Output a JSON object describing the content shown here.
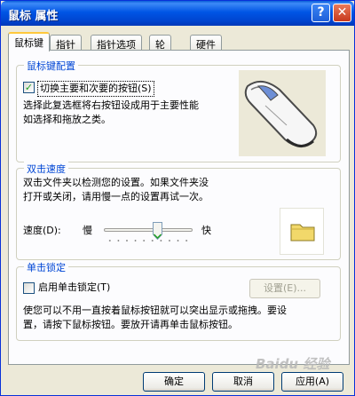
{
  "window": {
    "title": "鼠标 属性",
    "help_btn": "?",
    "close_btn": "✕"
  },
  "tabs": [
    {
      "label": "鼠标键",
      "active": true
    },
    {
      "label": "指针",
      "active": false
    },
    {
      "label": "指针选项",
      "active": false
    },
    {
      "label": "轮",
      "active": false
    },
    {
      "label": "硬件",
      "active": false
    }
  ],
  "button_config": {
    "group_title": "鼠标键配置",
    "switch_checkbox": {
      "label": "切换主要和次要的按钮(S)",
      "checked": true
    },
    "description": [
      "选择此复选框将右按钮设成用于主要性能",
      "如选择和拖放之类。"
    ]
  },
  "double_click": {
    "group_title": "双击速度",
    "description": [
      "双击文件夹以检测您的设置。如果文件夹没",
      "打开或关闭，请用慢一点的设置再试一次。"
    ],
    "speed_label": "速度(D):",
    "slow_label": "慢",
    "fast_label": "快",
    "speed_value_fraction": 0.6
  },
  "click_lock": {
    "group_title": "单击锁定",
    "checkbox": {
      "label": "启用单击锁定(T)",
      "checked": false
    },
    "settings_button": "设置(E)...",
    "description": [
      "使您可以不用一直按着鼠标按钮就可以突出显示或拖拽。要设",
      "置，请按下鼠标按钮。要放开请再单击鼠标按钮。"
    ]
  },
  "footer": {
    "ok": "确定",
    "cancel": "取消",
    "apply": "应用(A)"
  },
  "watermark": "Baidu 经验"
}
